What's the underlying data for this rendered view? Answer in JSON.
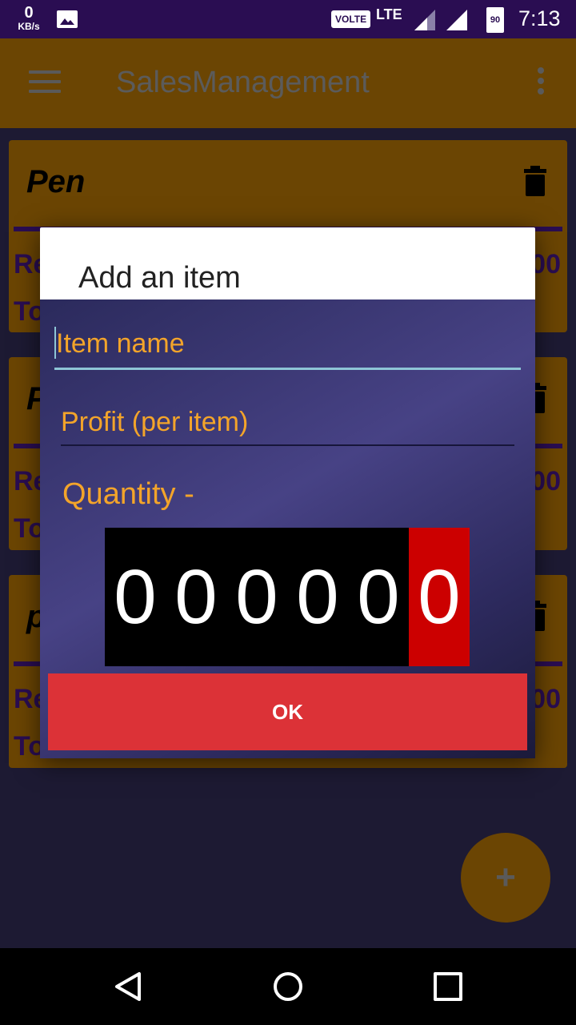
{
  "status_bar": {
    "speed_value": "0",
    "speed_unit": "KB/s",
    "volte": "VOLTE",
    "network": "LTE",
    "battery": "90",
    "time": "7:13"
  },
  "app_bar": {
    "title": "SalesManagement",
    "menu_icon": "hamburger-menu-icon",
    "overflow_icon": "more-vert-icon"
  },
  "cards": [
    {
      "title": "Pen",
      "row1_label": "Re",
      "row1_value": "00",
      "row2_label": "To"
    },
    {
      "title": "P",
      "row1_label": "Re",
      "row1_value": "00",
      "row2_label": "To"
    },
    {
      "title": "p",
      "row1_label": "Re",
      "row1_value": "00",
      "row2_label": "To"
    }
  ],
  "dialog": {
    "title": "Add an item",
    "item_name_placeholder": "Item name",
    "profit_placeholder": "Profit (per item)",
    "quantity_label": "Quantity -",
    "digits": [
      "0",
      "0",
      "0",
      "0",
      "0",
      "0"
    ],
    "ok_label": "OK"
  },
  "fab": {
    "label": "+"
  },
  "colors": {
    "status_bar": "#2a0d52",
    "app_bar_dimmed": "#6b4503",
    "accent_text": "#f3a42a",
    "ok_button": "#dc3237",
    "active_digit": "#cc0000"
  }
}
